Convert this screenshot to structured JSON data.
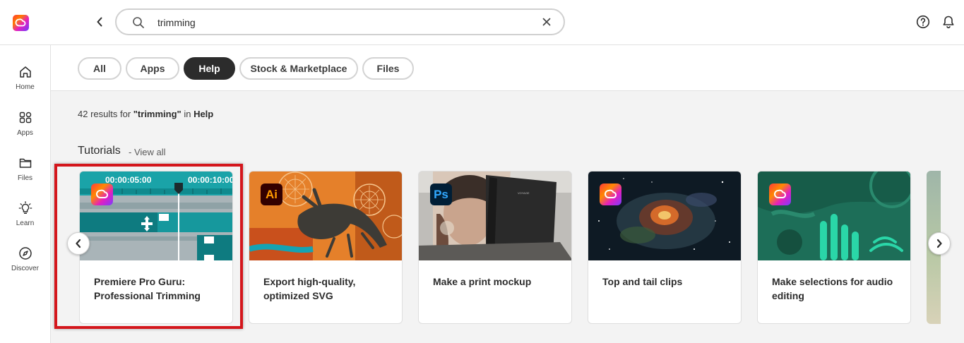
{
  "search": {
    "value": "trimming",
    "placeholder": "Search"
  },
  "sidebar": {
    "items": [
      {
        "label": "Home",
        "icon": "home-icon"
      },
      {
        "label": "Apps",
        "icon": "apps-icon"
      },
      {
        "label": "Files",
        "icon": "folder-icon"
      },
      {
        "label": "Learn",
        "icon": "lightbulb-icon"
      },
      {
        "label": "Discover",
        "icon": "compass-icon"
      }
    ]
  },
  "filters": [
    {
      "label": "All",
      "active": false
    },
    {
      "label": "Apps",
      "active": false
    },
    {
      "label": "Help",
      "active": true
    },
    {
      "label": "Stock & Marketplace",
      "active": false
    },
    {
      "label": "Files",
      "active": false
    }
  ],
  "results": {
    "count_text": "42 results for ",
    "query": "\"trimming\"",
    "in_text": " in ",
    "scope": "Help"
  },
  "tutorials": {
    "title": "Tutorials",
    "view_all": "- View all",
    "cards": [
      {
        "title": "Premiere Pro Guru: Professional Trimming",
        "badge": "cc",
        "timecode_1": "00:00:05:00",
        "timecode_2": "00:00:10:00"
      },
      {
        "title": "Export high-quality, optimized SVG",
        "badge": "ai",
        "badge_text": "Ai"
      },
      {
        "title": "Make a print mockup",
        "badge": "ps",
        "badge_text": "Ps"
      },
      {
        "title": "Top and tail clips",
        "badge": "cc"
      },
      {
        "title": "Make selections for audio editing",
        "badge": "cc"
      }
    ]
  },
  "colors": {
    "highlight": "#d4161c",
    "active_chip": "#2c2c2c",
    "background": "#f3f3f3"
  }
}
